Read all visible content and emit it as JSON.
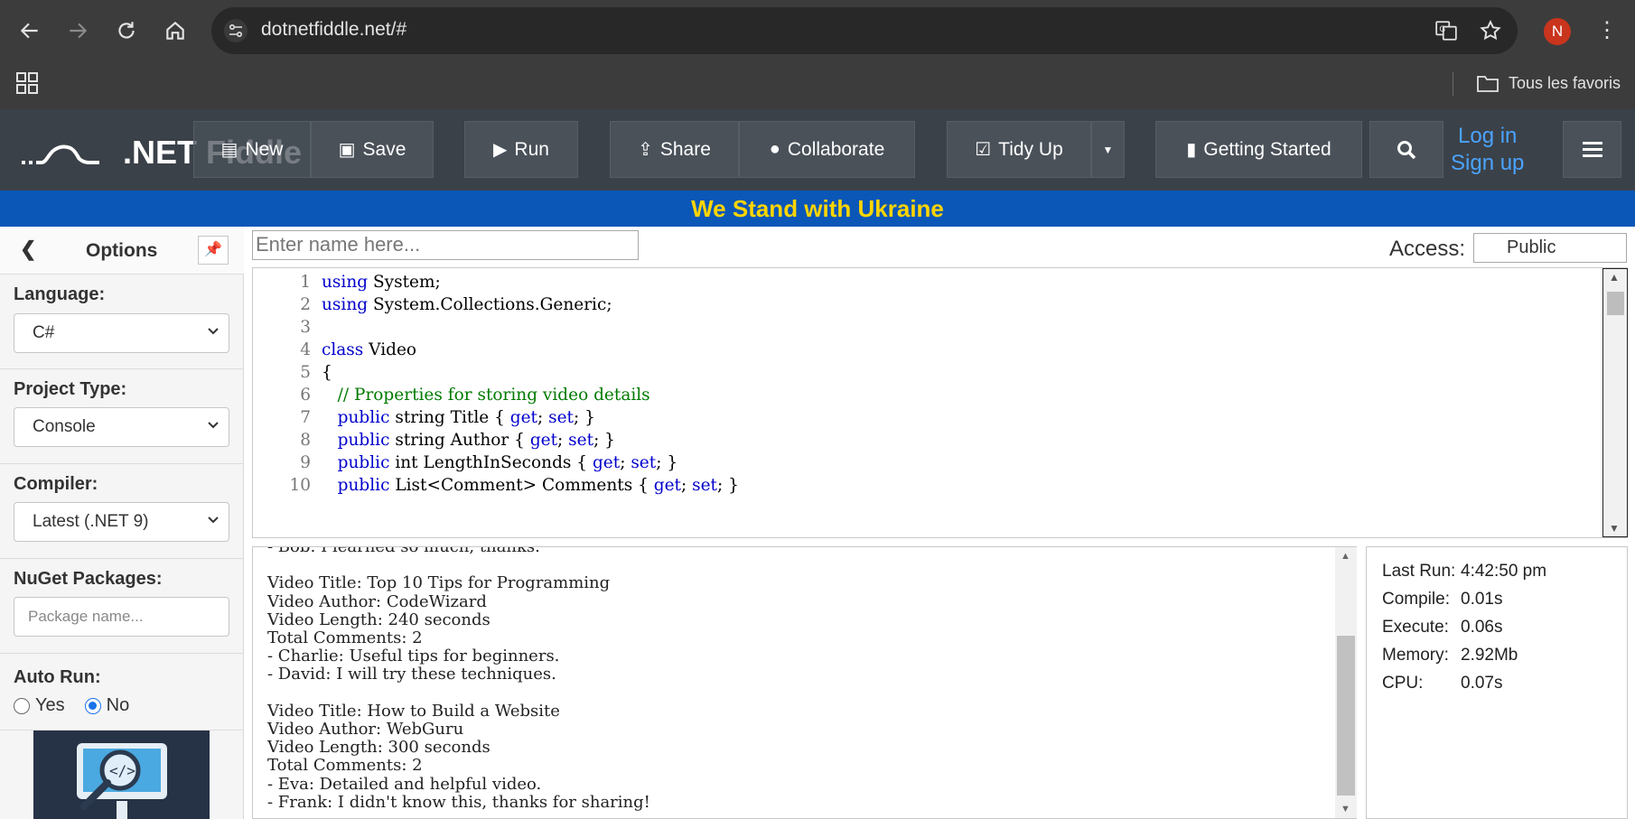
{
  "browser": {
    "url": "dotnetfiddle.net/#",
    "avatar_initial": "N",
    "all_bookmarks": "Tous les favoris"
  },
  "header": {
    "logo_text": ".NET Fiddle",
    "new_label": "New",
    "save_label": "Save",
    "run_label": "Run",
    "share_label": "Share",
    "collaborate_label": "Collaborate",
    "tidy_label": "Tidy Up",
    "getting_started_label": "Getting Started",
    "login_label": "Log in",
    "signup_label": "Sign up"
  },
  "banner": {
    "text": "We Stand with Ukraine"
  },
  "sidebar": {
    "title": "Options",
    "language_label": "Language:",
    "language_value": "C#",
    "project_type_label": "Project Type:",
    "project_type_value": "Console",
    "compiler_label": "Compiler:",
    "compiler_value": "Latest (.NET 9)",
    "nuget_label": "NuGet Packages:",
    "nuget_placeholder": "Package name...",
    "autorun_label": "Auto Run:",
    "autorun_yes": "Yes",
    "autorun_no": "No",
    "autorun_selected": "No"
  },
  "main": {
    "name_placeholder": "Enter name here...",
    "access_label": "Access:",
    "access_value": "Public"
  },
  "editor": {
    "lines": [
      {
        "n": "1",
        "parts": [
          [
            "kw",
            "using"
          ],
          [
            "t",
            " System;"
          ]
        ]
      },
      {
        "n": "2",
        "parts": [
          [
            "kw",
            "using"
          ],
          [
            "t",
            " System.Collections.Generic;"
          ]
        ]
      },
      {
        "n": "3",
        "parts": []
      },
      {
        "n": "4",
        "parts": [
          [
            "kw",
            "class"
          ],
          [
            "t",
            " Video"
          ]
        ]
      },
      {
        "n": "5",
        "parts": [
          [
            "t",
            "{"
          ]
        ]
      },
      {
        "n": "6",
        "parts": [
          [
            "t",
            "   "
          ],
          [
            "cm",
            "// Properties for storing video details"
          ]
        ]
      },
      {
        "n": "7",
        "parts": [
          [
            "t",
            "   "
          ],
          [
            "kw",
            "public"
          ],
          [
            "t",
            " string Title { "
          ],
          [
            "kw",
            "get"
          ],
          [
            "t",
            "; "
          ],
          [
            "kw",
            "set"
          ],
          [
            "t",
            "; }"
          ]
        ]
      },
      {
        "n": "8",
        "parts": [
          [
            "t",
            "   "
          ],
          [
            "kw",
            "public"
          ],
          [
            "t",
            " string Author { "
          ],
          [
            "kw",
            "get"
          ],
          [
            "t",
            "; "
          ],
          [
            "kw",
            "set"
          ],
          [
            "t",
            "; }"
          ]
        ]
      },
      {
        "n": "9",
        "parts": [
          [
            "t",
            "   "
          ],
          [
            "kw",
            "public"
          ],
          [
            "t",
            " int LengthInSeconds { "
          ],
          [
            "kw",
            "get"
          ],
          [
            "t",
            "; "
          ],
          [
            "kw",
            "set"
          ],
          [
            "t",
            "; }"
          ]
        ]
      },
      {
        "n": "10",
        "parts": [
          [
            "t",
            "   "
          ],
          [
            "kw",
            "public"
          ],
          [
            "t",
            " List<Comment> Comments { "
          ],
          [
            "kw",
            "get"
          ],
          [
            "t",
            "; "
          ],
          [
            "kw",
            "set"
          ],
          [
            "t",
            "; }"
          ]
        ]
      }
    ]
  },
  "output": {
    "lines": [
      "- Bob: I learned so much, thanks.",
      "",
      "Video Title: Top 10 Tips for Programming",
      "Video Author: CodeWizard",
      "Video Length: 240 seconds",
      "Total Comments: 2",
      "- Charlie: Useful tips for beginners.",
      "- David: I will try these techniques.",
      "",
      "Video Title: How to Build a Website",
      "Video Author: WebGuru",
      "Video Length: 300 seconds",
      "Total Comments: 2",
      "- Eva: Detailed and helpful video.",
      "- Frank: I didn't know this, thanks for sharing!"
    ]
  },
  "stats": {
    "last_run_label": "Last Run:",
    "last_run_value": "4:42:50 pm",
    "compile_label": "Compile:",
    "compile_value": "0.01s",
    "execute_label": "Execute:",
    "execute_value": "0.06s",
    "memory_label": "Memory:",
    "memory_value": "2.92Mb",
    "cpu_label": "CPU:",
    "cpu_value": "0.07s"
  },
  "colors": {
    "banner_bg": "#0b57b7",
    "banner_text": "#ffd500",
    "header_bg": "#3b4148",
    "keyword": "#0000cc",
    "comment": "#007a00",
    "link": "#4aa3ff"
  }
}
